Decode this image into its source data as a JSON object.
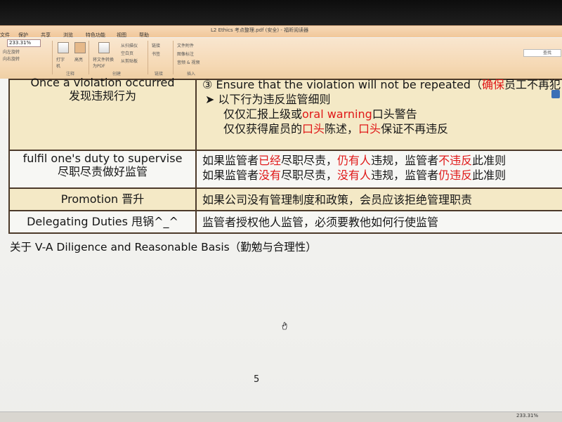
{
  "window": {
    "title": "L2 Ethics 考点整理.pdf (安全) - 福昕阅读器"
  },
  "menu": [
    "文件",
    "保护",
    "共享",
    "浏览",
    "特色功能",
    "视图",
    "帮助"
  ],
  "toolbar": {
    "zoom": "233.31%",
    "rotate_left": "向左旋转",
    "rotate_right": "向右旋转",
    "typewriter": "打字机",
    "highlight": "高亮",
    "annotate_group": "注释",
    "convert_pdf": "将文件转换为PDF",
    "from_scanner": "从扫描仪",
    "blank_page": "空白页",
    "from_clipboard": "从剪贴板",
    "create_group": "创建",
    "link": "链接",
    "bookmark": "书签",
    "link_group": "链接",
    "file_attachment": "文件附件",
    "image_annotation": "图像标注",
    "audio_video": "音频 & 视频",
    "insert_group": "插入",
    "search_label": "查找"
  },
  "table": {
    "rows": [
      {
        "left": [
          "Once a violation occurred",
          "发现违规行为"
        ],
        "right": [
          [
            "③ Ensure that the violation will not be repeated（",
            {
              "red": "确保"
            },
            "员工不再犯"
          ],
          [
            "➤ 以下行为违反监管细则"
          ],
          [
            "仅仅汇报上级或",
            {
              "red": "oral warning"
            },
            "口头警告"
          ],
          [
            "仅仅获得雇员的",
            {
              "red": "口头"
            },
            "陈述，",
            {
              "red": "口头"
            },
            "保证不再违反"
          ]
        ]
      },
      {
        "left": [
          "fulfil one's duty to supervise",
          "尽职尽责做好监管"
        ],
        "right": [
          [
            "如果监管者",
            {
              "red": "已经"
            },
            "尽职尽责，",
            {
              "red": "仍有人"
            },
            "违规，监管者",
            {
              "red": "不违反"
            },
            "此准则"
          ],
          [
            "如果监管者",
            {
              "red": "没有"
            },
            "尽职尽责，",
            {
              "red": "没有人"
            },
            "违规，监管者",
            {
              "red": "仍违反"
            },
            "此准则"
          ]
        ]
      },
      {
        "left": [
          "Promotion   晋升"
        ],
        "right": [
          [
            "如果公司没有管理制度和政策，会员应该拒绝管理职责"
          ]
        ]
      },
      {
        "left": [
          "Delegating Duties 甩锅^_^"
        ],
        "right": [
          [
            "监管者授权他人监管，必须要教他如何行使监管"
          ]
        ]
      }
    ]
  },
  "heading": "关于 V-A Diligence and Reasonable Basis（勤勉与合理性）",
  "page_number": "5",
  "status": {
    "zoom": "233.31%"
  },
  "colors": {
    "highlight_red": "#e01818",
    "table_tan": "#f4e9c6",
    "ribbon": "#f5d8b3"
  }
}
